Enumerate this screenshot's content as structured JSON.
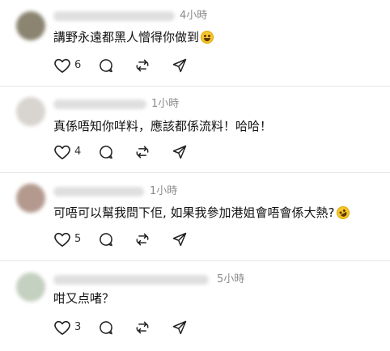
{
  "comments": [
    {
      "time": "4小時",
      "text": "講野永遠都黑人憎得你做到",
      "emoji": "grinning-face-emoji",
      "likes": "6",
      "avatar_color": "#8a8470"
    },
    {
      "time": "1小時",
      "text": "真係唔知你咩料，應該都係流料！哈哈！",
      "emoji": "",
      "likes": "4",
      "avatar_color": "#d8d4d0"
    },
    {
      "time": "1小時",
      "text": "可唔可以幫我問下佢, 如果我參加港姐會唔會係大熱?",
      "emoji": "rolling-laughing-emoji",
      "likes": "5",
      "avatar_color": "#b49a8e"
    },
    {
      "time": "5小時",
      "text": "咁又点啫？",
      "emoji": "",
      "likes": "3",
      "avatar_color": "#c4d0c0"
    }
  ],
  "icons": {
    "like": "heart-icon",
    "reply": "comment-bubble-icon",
    "repost": "repost-icon",
    "share": "send-icon"
  }
}
